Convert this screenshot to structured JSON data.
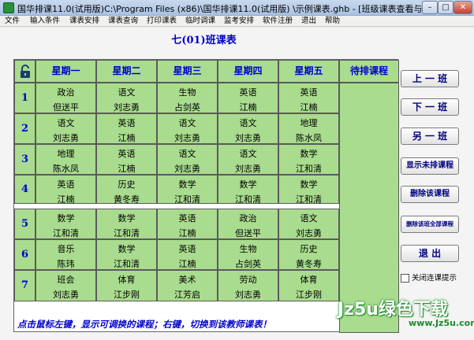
{
  "window": {
    "title": "国华排课11.0(试用版)C:\\Program Files (x86)\\国华排课11.0(试用版) \\示例课表.ghb - [班级课表查看与调整]",
    "min_label": "–",
    "max_label": "□",
    "close_label": "✕"
  },
  "menu": [
    "文件",
    "输入条件",
    "课表安排",
    "课表查询",
    "打印课表",
    "临时调课",
    "监考安排",
    "软件注册",
    "退出",
    "帮助"
  ],
  "class_title": "七(01)班课表",
  "headers": [
    "星期一",
    "星期二",
    "星期三",
    "星期四",
    "星期五",
    "待排课程"
  ],
  "periods": [
    "1",
    "2",
    "3",
    "4",
    "5",
    "6",
    "7"
  ],
  "schedule": [
    [
      {
        "s": "政治",
        "t": "但送平"
      },
      {
        "s": "语文",
        "t": "刘志勇"
      },
      {
        "s": "生物",
        "t": "占剑英"
      },
      {
        "s": "英语",
        "t": "江楠"
      },
      {
        "s": "英语",
        "t": "江楠"
      }
    ],
    [
      {
        "s": "语文",
        "t": "刘志勇"
      },
      {
        "s": "英语",
        "t": "江楠"
      },
      {
        "s": "语文",
        "t": "刘志勇"
      },
      {
        "s": "语文",
        "t": "刘志勇"
      },
      {
        "s": "地理",
        "t": "陈水凤"
      }
    ],
    [
      {
        "s": "地理",
        "t": "陈水凤"
      },
      {
        "s": "英语",
        "t": "江楠"
      },
      {
        "s": "语文",
        "t": "刘志勇"
      },
      {
        "s": "语文",
        "t": "刘志勇"
      },
      {
        "s": "数学",
        "t": "江和清"
      }
    ],
    [
      {
        "s": "英语",
        "t": "江楠"
      },
      {
        "s": "历史",
        "t": "黄冬寿"
      },
      {
        "s": "数学",
        "t": "江和清"
      },
      {
        "s": "数学",
        "t": "江和清"
      },
      {
        "s": "数学",
        "t": "江和清"
      }
    ],
    [
      {
        "s": "数学",
        "t": "江和清"
      },
      {
        "s": "数学",
        "t": "江和清"
      },
      {
        "s": "英语",
        "t": "江楠"
      },
      {
        "s": "政治",
        "t": "但送平"
      },
      {
        "s": "语文",
        "t": "刘志勇"
      }
    ],
    [
      {
        "s": "音乐",
        "t": "陈玮"
      },
      {
        "s": "数学",
        "t": "江和清"
      },
      {
        "s": "英语",
        "t": "江楠"
      },
      {
        "s": "生物",
        "t": "占剑英"
      },
      {
        "s": "历史",
        "t": "黄冬寿"
      }
    ],
    [
      {
        "s": "班会",
        "t": "刘志勇"
      },
      {
        "s": "体育",
        "t": "江步刚"
      },
      {
        "s": "美术",
        "t": "江芳启"
      },
      {
        "s": "劳动",
        "t": "刘志勇"
      },
      {
        "s": "体育",
        "t": "江步刚"
      }
    ]
  ],
  "buttons": {
    "prev_class": "上 一 班",
    "next_class": "下 一 班",
    "other_class": "另 一 班",
    "show_unscheduled": "显示未排课程",
    "delete_course": "删除该课程",
    "delete_all": "删除该班全部课程",
    "exit": "退 出"
  },
  "checkbox_label": "关闭连课提示",
  "hint": "点击鼠标左键，显示可调换的课程；右键，切换到该教师课表！",
  "watermark": "Jz5u绿色下载",
  "watermark_url": "www.Jz5u.com",
  "colors": {
    "cell_bg": "#a9dc8e",
    "header_text": "#0000cc",
    "button_text": "#000080"
  }
}
